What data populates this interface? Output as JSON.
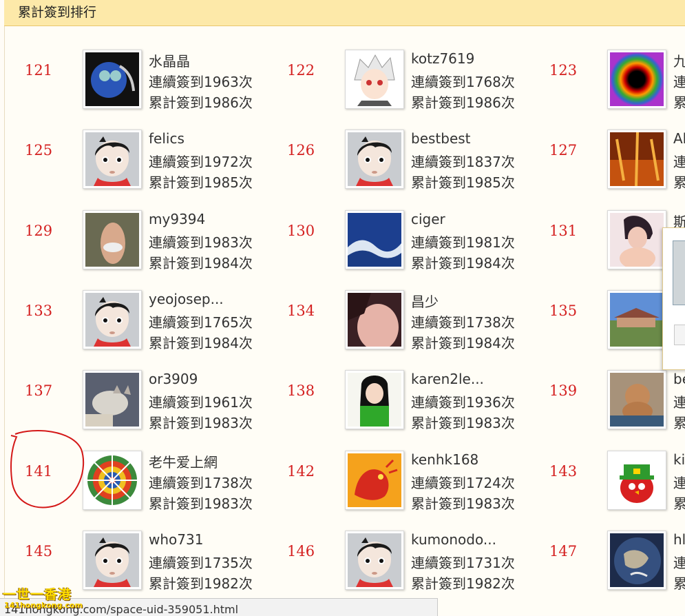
{
  "header": {
    "title": "累計簽到排行"
  },
  "entries": [
    {
      "rank": "121",
      "name": "水晶晶",
      "streak": "連續簽到1963次",
      "total": "累計簽到1986次",
      "avatar": "robot-photo"
    },
    {
      "rank": "122",
      "name": "kotz7619",
      "streak": "連續簽到1768次",
      "total": "累計簽到1986次",
      "avatar": "anime-boy"
    },
    {
      "rank": "123",
      "name": "九",
      "streak": "連",
      "total": "累",
      "avatar": "color-swirl"
    },
    {
      "rank": "125",
      "name": "felics",
      "streak": "連續簽到1972次",
      "total": "累計簽到1985次",
      "avatar": "default-avatar"
    },
    {
      "rank": "126",
      "name": "bestbest",
      "streak": "連續簽到1837次",
      "total": "累計簽到1985次",
      "avatar": "default-avatar"
    },
    {
      "rank": "127",
      "name": "Al",
      "streak": "連",
      "total": "累",
      "avatar": "orange-photo"
    },
    {
      "rank": "129",
      "name": "my9394",
      "streak": "連續簽到1983次",
      "total": "累計簽到1984次",
      "avatar": "person-photo"
    },
    {
      "rank": "130",
      "name": "ciger",
      "streak": "連續簽到1981次",
      "total": "累計簽到1984次",
      "avatar": "blue-texture"
    },
    {
      "rank": "131",
      "name": "斯",
      "streak": "連",
      "total": "累",
      "avatar": "face-photo"
    },
    {
      "rank": "133",
      "name": "yeojosep...",
      "streak": "連續簽到1765次",
      "total": "累計簽到1984次",
      "avatar": "default-avatar"
    },
    {
      "rank": "134",
      "name": "昌少",
      "streak": "連續簽到1738次",
      "total": "累計簽到1984次",
      "avatar": "skin-photo"
    },
    {
      "rank": "135",
      "name": "",
      "streak": "",
      "total": "",
      "avatar": "house-photo"
    },
    {
      "rank": "137",
      "name": "or3909",
      "streak": "連續簽到1961次",
      "total": "累計簽到1983次",
      "avatar": "cat-photo"
    },
    {
      "rank": "138",
      "name": "karen2le...",
      "streak": "連續簽到1936次",
      "total": "累計簽到1983次",
      "avatar": "girl-photo"
    },
    {
      "rank": "139",
      "name": "be",
      "streak": "連",
      "total": "累",
      "avatar": "dog-photo"
    },
    {
      "rank": "141",
      "name": "老牛爱上網",
      "streak": "連續簽到1738次",
      "total": "累計簽到1983次",
      "avatar": "kaleidoscope"
    },
    {
      "rank": "142",
      "name": "kenhk168",
      "streak": "連續簽到1724次",
      "total": "累計簽到1983次",
      "avatar": "dragon"
    },
    {
      "rank": "143",
      "name": "ki",
      "streak": "連",
      "total": "累",
      "avatar": "angry-bird"
    },
    {
      "rank": "145",
      "name": "who731",
      "streak": "連續簽到1735次",
      "total": "累計簽到1982次",
      "avatar": "default-avatar"
    },
    {
      "rank": "146",
      "name": "kumonodo...",
      "streak": "連續簽到1731次",
      "total": "累計簽到1982次",
      "avatar": "default-avatar"
    },
    {
      "rank": "147",
      "name": "hl",
      "streak": "連",
      "total": "累",
      "avatar": "earth-photo"
    }
  ],
  "status_bar": {
    "url": "141hongkong.com/space-uid-359051.html"
  },
  "watermark": {
    "line1": "一世一香港",
    "line2": "141hongkong.com"
  },
  "colors": {
    "header_bg": "#fde9a9",
    "rank_red": "#d42020",
    "annotation_red": "#d41818"
  }
}
